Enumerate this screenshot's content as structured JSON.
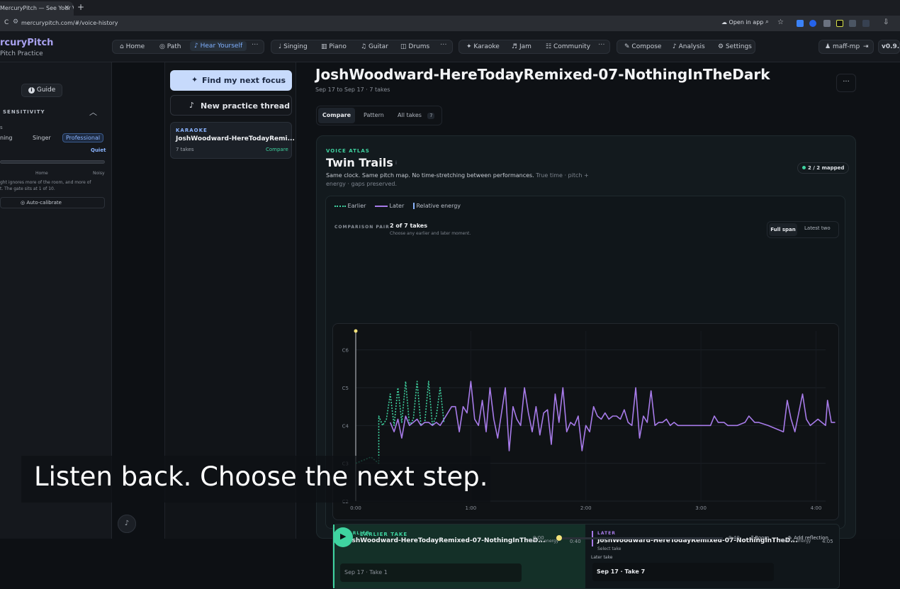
{
  "browser": {
    "tab_title": "MercuryPitch — See Your Vo",
    "tab_close": "×",
    "new_tab": "+",
    "reload": "C",
    "url": "mercurypitch.com/#/voice-history",
    "open_in_app": "Open in app",
    "toolbar_glyphs": [
      "⌕",
      "☆",
      "⇩"
    ]
  },
  "app": {
    "brand": "rcuryPitch",
    "brand_sub": "Pitch Practice",
    "nav_groups": [
      {
        "items": [
          {
            "icon": "home-icon",
            "label": "Home"
          },
          {
            "icon": "path-icon",
            "label": "Path"
          },
          {
            "icon": "ear-icon",
            "label": "Hear Yourself",
            "active": true
          }
        ]
      },
      {
        "items": [
          {
            "icon": "mic-icon",
            "label": "Singing"
          },
          {
            "icon": "piano-icon",
            "label": "Piano"
          },
          {
            "icon": "guitar-icon",
            "label": "Guitar"
          },
          {
            "icon": "drums-icon",
            "label": "Drums"
          }
        ]
      },
      {
        "items": [
          {
            "icon": "karaoke-icon",
            "label": "Karaoke"
          },
          {
            "icon": "jam-icon",
            "label": "Jam"
          },
          {
            "icon": "community-icon",
            "label": "Community"
          }
        ]
      },
      {
        "items": [
          {
            "icon": "compose-icon",
            "label": "Compose"
          },
          {
            "icon": "analysis-icon",
            "label": "Analysis"
          },
          {
            "icon": "settings-icon",
            "label": "Settings"
          }
        ]
      }
    ],
    "more_glyph": "···",
    "user": "maff-mp",
    "version": "v0.9.7"
  },
  "left": {
    "guide": "Guide",
    "sensitivity_title": "SENSITIVITY",
    "sens_sub": "s",
    "modes": [
      "ning",
      "Singer",
      "Professional"
    ],
    "quiet_label": "Quiet",
    "scale_labels": [
      "Home",
      "Noisy"
    ],
    "help_text_1": "ght ignores more of the room, and more of",
    "help_text_2": "t. The gate sits at 1 of 10.",
    "auto_calibrate": "Auto-calibrate"
  },
  "middle": {
    "find_focus": "Find my next focus",
    "new_thread": "New practice thread",
    "thread": {
      "tag": "KARAOKE",
      "title": "JoshWoodward-HereTodayRemi...",
      "takes": "7 takes",
      "action": "Compare"
    }
  },
  "main": {
    "title": "JoshWoodward-HereTodayRemixed-07-NothingInTheDark",
    "subtitle": "Sep 17 to Sep 17 · 7 takes",
    "tabs": [
      {
        "label": "Compare",
        "active": true
      },
      {
        "label": "Pattern"
      },
      {
        "label": "All takes",
        "badge": "7"
      }
    ],
    "atlas": {
      "eyebrow": "VOICE ATLAS",
      "title": "Twin Trails",
      "title_mark": "i",
      "desc_1": "Same clock. Same pitch map. No time-stretching between performances.",
      "desc_1b": "True time · pitch +",
      "desc_2": "energy · gaps preserved.",
      "mapped": "2 / 2 mapped",
      "legend": [
        "Earlier",
        "Later",
        "Relative energy"
      ],
      "comparison_label": "COMPARISON PAIR",
      "comparison_value": "2 of 7 takes",
      "comparison_hint": "Choose any earlier and later moment.",
      "span_options": [
        {
          "label": "Full span",
          "active": true
        },
        {
          "label": "Latest two"
        }
      ]
    },
    "earlier": {
      "tag": "EARLIER",
      "title": "JoshWoodward-HereTodayRemixed-07-NothingInTheD...",
      "meta": "Pitch + energy",
      "time": "0:40",
      "select": "Sep 17 · Take 1"
    },
    "later": {
      "tag": "LATER",
      "title": "JoshWoodward-HereTodayRemixed-07-NothingInTheD...",
      "meta": "Pitch + energy",
      "time": "4:05",
      "select_label": "Select take",
      "field_label": "Later take",
      "select": "Sep 17 · Take 7"
    },
    "player": {
      "label": "EARLIER TAKE",
      "start": "0:00",
      "end": "0:40",
      "room": "Room",
      "add": "Add reflection"
    }
  },
  "caption": "Listen back. Choose the next step.",
  "chart_data": {
    "type": "line",
    "y_ticks": [
      "C2",
      "C3",
      "C4",
      "C5",
      "C6"
    ],
    "x_ticks": [
      "0:00",
      "1:00",
      "2:00",
      "3:00",
      "4:00"
    ],
    "x_range_seconds": [
      0,
      245
    ],
    "y_range_semitones": [
      36,
      90
    ],
    "grid": true,
    "legend": "top-left",
    "series": [
      {
        "name": "Earlier",
        "style": "dotted",
        "color": "#3fd3a0",
        "points_seconds_semitone": [
          [
            0,
            48
          ],
          [
            4,
            49
          ],
          [
            8,
            50
          ],
          [
            12,
            48
          ],
          [
            12,
            63
          ],
          [
            14,
            60
          ],
          [
            16,
            62
          ],
          [
            18,
            70
          ],
          [
            20,
            60
          ],
          [
            22,
            72
          ],
          [
            24,
            61
          ],
          [
            26,
            74
          ],
          [
            28,
            60
          ],
          [
            30,
            62
          ],
          [
            32,
            74
          ],
          [
            34,
            60
          ],
          [
            36,
            61
          ],
          [
            38,
            74
          ],
          [
            40,
            60
          ],
          [
            42,
            63
          ],
          [
            44,
            72
          ],
          [
            46,
            61
          ]
        ]
      },
      {
        "name": "Later",
        "style": "solid",
        "color": "#a77be9",
        "points_seconds_semitone": [
          [
            18,
            61
          ],
          [
            20,
            58
          ],
          [
            22,
            62
          ],
          [
            24,
            56
          ],
          [
            26,
            63
          ],
          [
            28,
            60
          ],
          [
            30,
            61
          ],
          [
            32,
            62
          ],
          [
            34,
            60
          ],
          [
            36,
            61
          ],
          [
            38,
            61
          ],
          [
            40,
            60
          ],
          [
            42,
            61
          ],
          [
            44,
            60
          ],
          [
            46,
            62
          ],
          [
            48,
            64
          ],
          [
            50,
            66
          ],
          [
            52,
            66
          ],
          [
            54,
            58
          ],
          [
            56,
            66
          ],
          [
            58,
            64
          ],
          [
            60,
            74
          ],
          [
            62,
            62
          ],
          [
            64,
            60
          ],
          [
            66,
            68
          ],
          [
            68,
            58
          ],
          [
            70,
            72
          ],
          [
            72,
            62
          ],
          [
            74,
            56
          ],
          [
            76,
            64
          ],
          [
            78,
            72
          ],
          [
            80,
            52
          ],
          [
            82,
            66
          ],
          [
            84,
            62
          ],
          [
            86,
            60
          ],
          [
            88,
            72
          ],
          [
            90,
            64
          ],
          [
            92,
            58
          ],
          [
            94,
            66
          ],
          [
            96,
            57
          ],
          [
            98,
            64
          ],
          [
            100,
            65
          ],
          [
            102,
            54
          ],
          [
            104,
            70
          ],
          [
            106,
            61
          ],
          [
            108,
            72
          ],
          [
            110,
            58
          ],
          [
            112,
            61
          ],
          [
            114,
            60
          ],
          [
            116,
            63
          ],
          [
            118,
            52
          ],
          [
            120,
            60
          ],
          [
            122,
            58
          ],
          [
            124,
            66
          ],
          [
            126,
            63
          ],
          [
            128,
            62
          ],
          [
            130,
            64
          ],
          [
            132,
            62
          ],
          [
            134,
            63
          ],
          [
            136,
            63
          ],
          [
            138,
            62
          ],
          [
            140,
            65
          ],
          [
            142,
            61
          ],
          [
            144,
            60
          ],
          [
            146,
            72
          ],
          [
            148,
            56
          ],
          [
            150,
            63
          ],
          [
            152,
            61
          ],
          [
            154,
            71
          ],
          [
            156,
            60
          ],
          [
            158,
            61
          ],
          [
            160,
            61
          ],
          [
            162,
            62
          ],
          [
            164,
            60
          ],
          [
            166,
            61
          ],
          [
            168,
            60
          ],
          [
            175,
            60
          ],
          [
            185,
            60
          ],
          [
            187,
            63
          ],
          [
            189,
            61
          ],
          [
            192,
            61
          ],
          [
            194,
            60
          ],
          [
            199,
            60
          ],
          [
            203,
            61
          ],
          [
            205,
            63
          ],
          [
            208,
            61
          ],
          [
            210,
            61
          ],
          [
            215,
            60
          ],
          [
            223,
            58
          ],
          [
            225,
            68
          ],
          [
            227,
            62
          ],
          [
            229,
            58
          ],
          [
            231,
            64
          ],
          [
            233,
            70
          ],
          [
            235,
            62
          ],
          [
            237,
            60
          ],
          [
            239,
            61
          ],
          [
            241,
            62
          ],
          [
            243,
            61
          ],
          [
            245,
            60
          ],
          [
            246,
            68
          ],
          [
            248,
            61
          ],
          [
            250,
            61
          ]
        ]
      }
    ]
  },
  "colors": {
    "accent": "#a77be9",
    "earlier": "#3fd3a0",
    "primary_button": "#c7dafc"
  }
}
